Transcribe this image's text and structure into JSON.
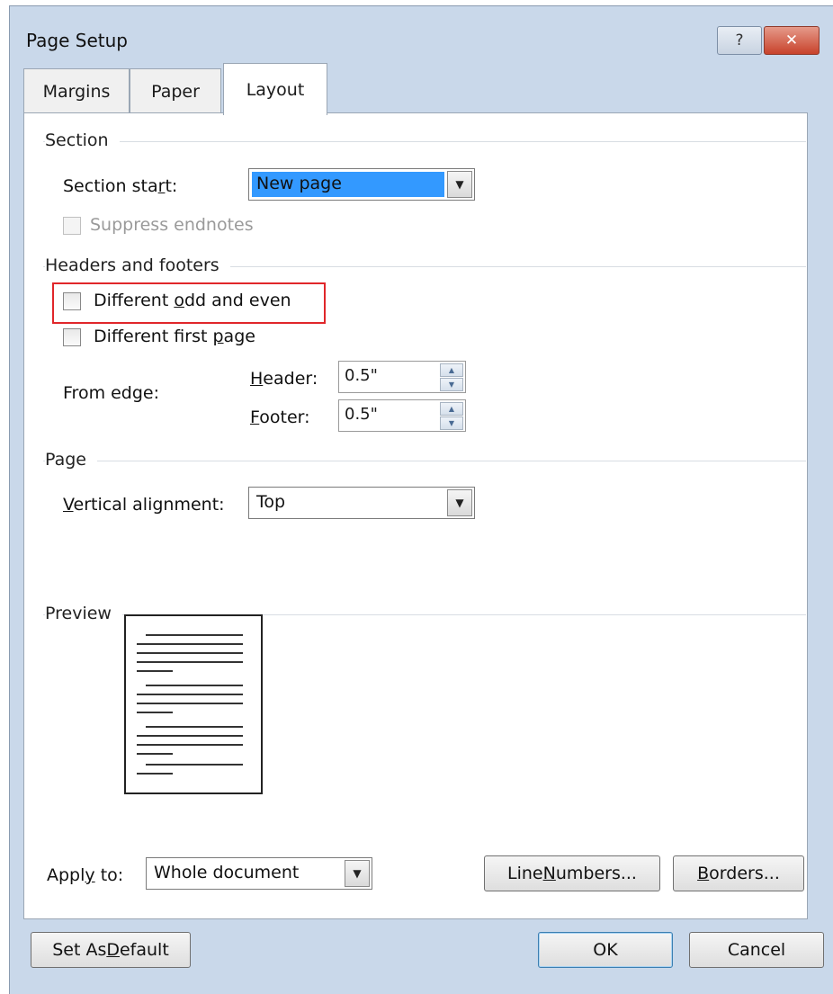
{
  "window": {
    "title": "Page Setup",
    "help_glyph": "?",
    "close_glyph": "✕"
  },
  "tabs": [
    {
      "label": "Margins",
      "active": false
    },
    {
      "label": "Paper",
      "active": false
    },
    {
      "label": "Layout",
      "active": true
    }
  ],
  "section": {
    "heading": "Section",
    "start_label_pre": "Section sta",
    "start_label_u": "r",
    "start_label_post": "t:",
    "start_value": "New page",
    "suppress_label": "Suppress endnotes"
  },
  "headers_footers": {
    "heading": "Headers and footers",
    "odd_even_pre": "Different ",
    "odd_even_u": "o",
    "odd_even_post": "dd and even",
    "first_page_pre": "Different first ",
    "first_page_u": "p",
    "first_page_post": "age",
    "from_edge_label": "From edge:",
    "header_u": "H",
    "header_post": "eader:",
    "header_value": "0.5\"",
    "footer_u": "F",
    "footer_post": "ooter:",
    "footer_value": "0.5\""
  },
  "page": {
    "heading": "Page",
    "valign_u": "V",
    "valign_post": "ertical alignment:",
    "valign_value": "Top"
  },
  "preview": {
    "heading": "Preview"
  },
  "apply": {
    "label_pre": "Appl",
    "label_u": "y",
    "label_post": " to:",
    "value": "Whole document"
  },
  "buttons": {
    "line_numbers_pre": "Line ",
    "line_numbers_u": "N",
    "line_numbers_post": "umbers...",
    "borders_u": "B",
    "borders_post": "orders...",
    "set_default_pre": "Set As ",
    "set_default_u": "D",
    "set_default_post": "efault",
    "ok": "OK",
    "cancel": "Cancel"
  },
  "colors": {
    "dialog_bg": "#c9d8ea",
    "highlight_box": "#e0262a",
    "selection": "#3399ff"
  }
}
